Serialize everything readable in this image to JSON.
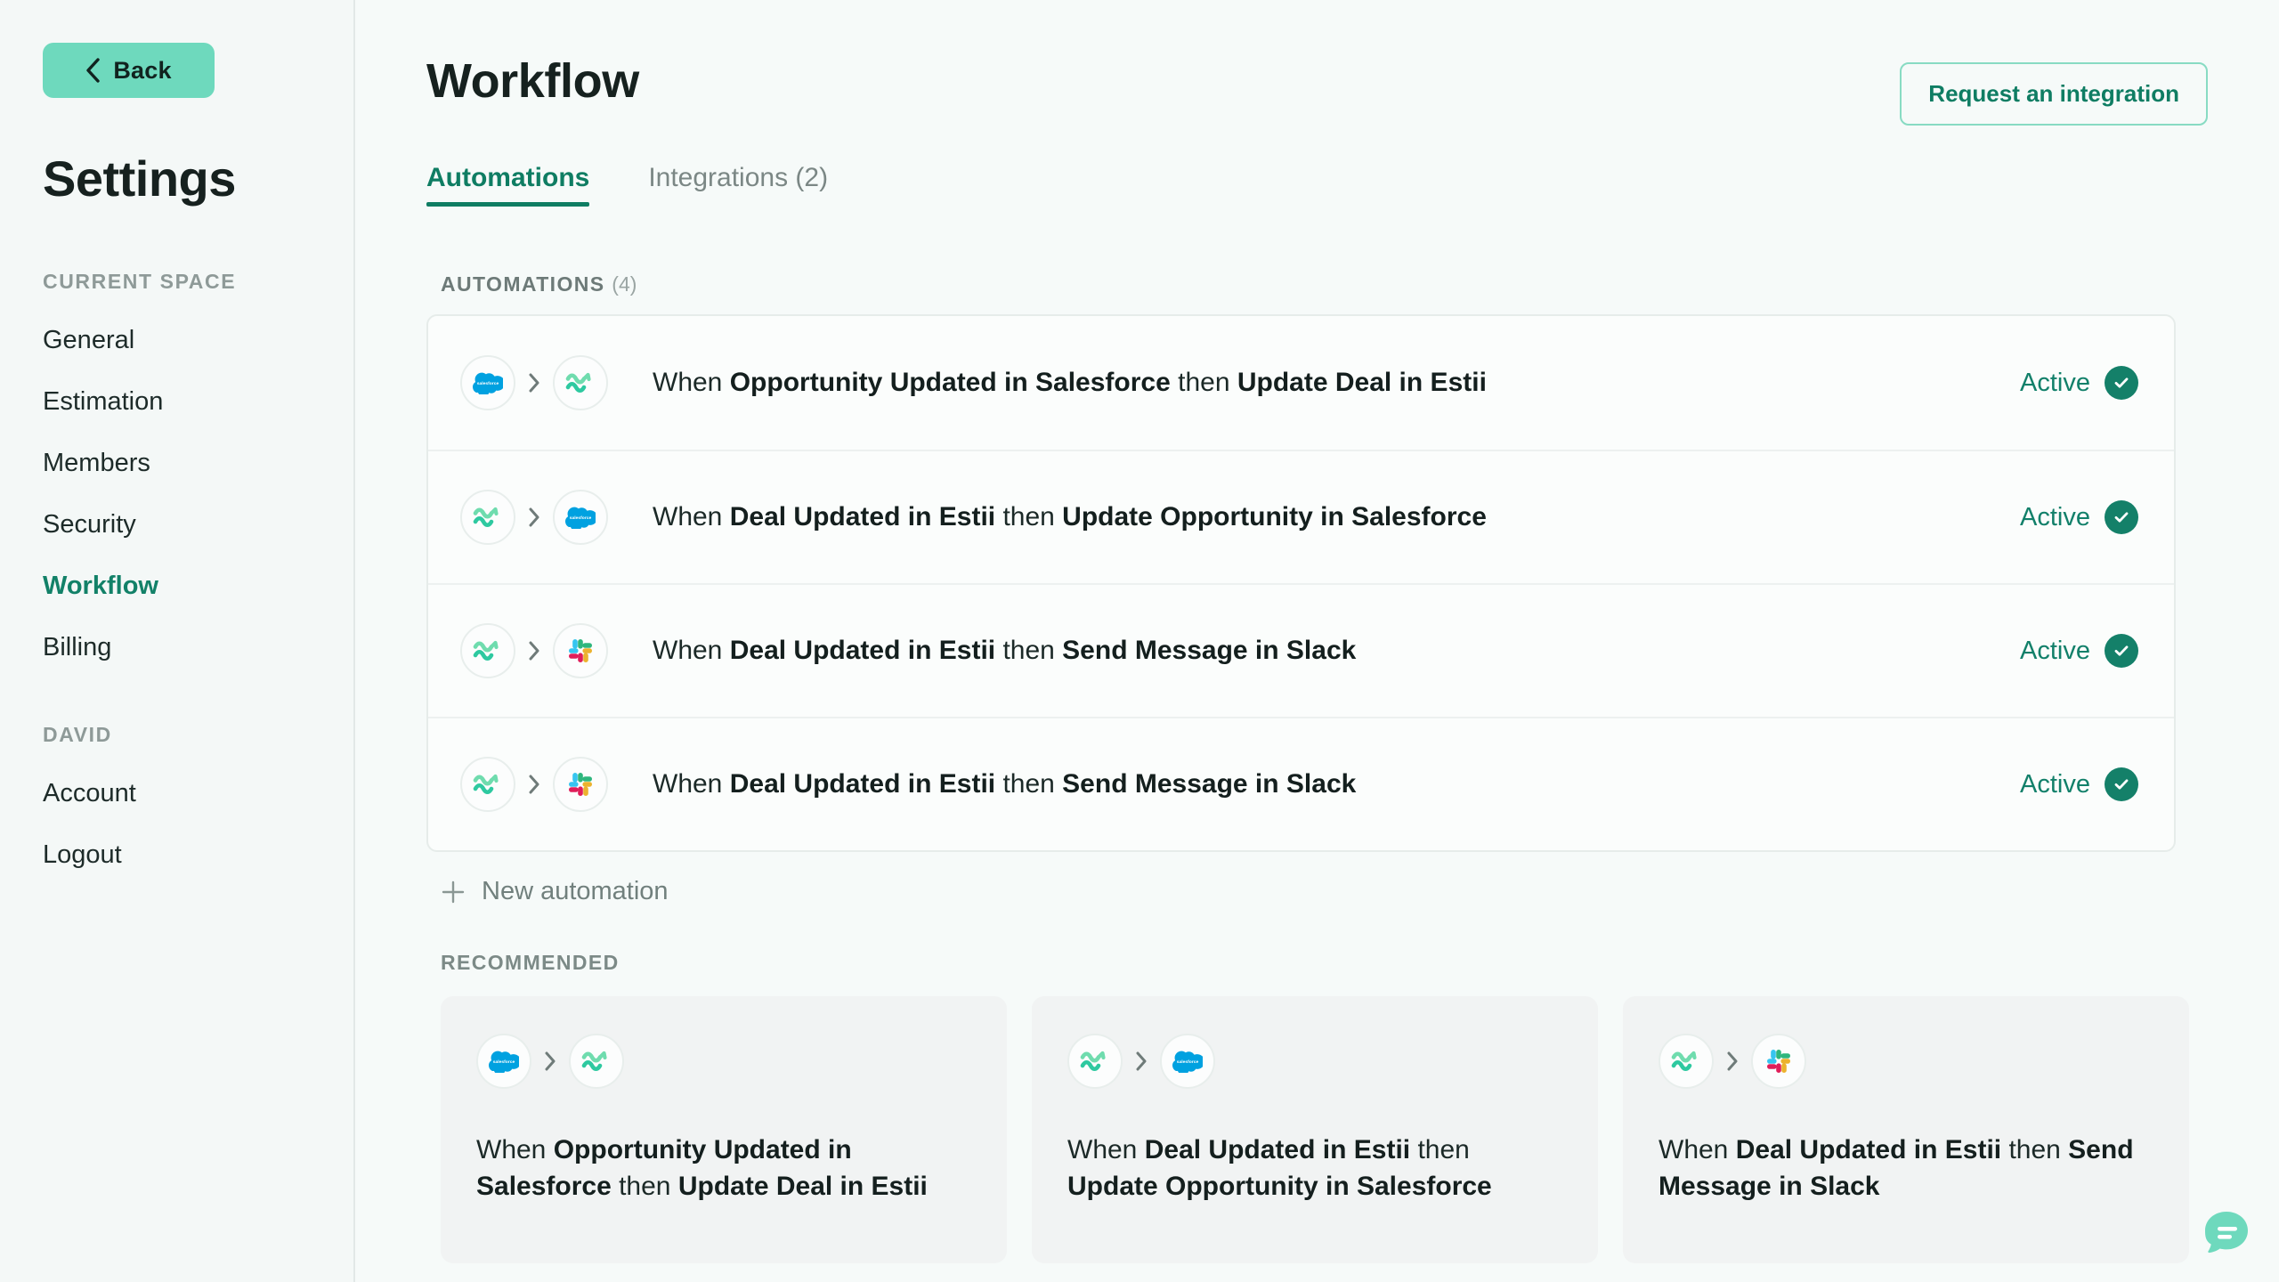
{
  "sidebar": {
    "back_label": "Back",
    "title": "Settings",
    "space_label": "CURRENT SPACE",
    "space_items": [
      {
        "label": "General",
        "active": false
      },
      {
        "label": "Estimation",
        "active": false
      },
      {
        "label": "Members",
        "active": false
      },
      {
        "label": "Security",
        "active": false
      },
      {
        "label": "Workflow",
        "active": true
      },
      {
        "label": "Billing",
        "active": false
      }
    ],
    "user_label": "DAVID",
    "user_items": [
      {
        "label": "Account"
      },
      {
        "label": "Logout"
      }
    ]
  },
  "header": {
    "title": "Workflow",
    "request_button": "Request an integration"
  },
  "tabs": [
    {
      "label": "Automations",
      "active": true
    },
    {
      "label": "Integrations (2)",
      "active": false
    }
  ],
  "automations_section": {
    "label": "AUTOMATIONS",
    "count": "(4)",
    "rows": [
      {
        "source_icon": "salesforce-icon",
        "target_icon": "estii-icon",
        "prefix": "When ",
        "trigger": "Opportunity Updated in Salesforce",
        "middle": " then ",
        "action": "Update Deal in Estii",
        "status": "Active"
      },
      {
        "source_icon": "estii-icon",
        "target_icon": "salesforce-icon",
        "prefix": "When ",
        "trigger": "Deal Updated in Estii",
        "middle": " then ",
        "action": "Update Opportunity in Salesforce",
        "status": "Active"
      },
      {
        "source_icon": "estii-icon",
        "target_icon": "slack-icon",
        "prefix": "When ",
        "trigger": "Deal Updated in Estii",
        "middle": " then ",
        "action": "Send Message in Slack",
        "status": "Active"
      },
      {
        "source_icon": "estii-icon",
        "target_icon": "slack-icon",
        "prefix": "When ",
        "trigger": "Deal Updated in Estii",
        "middle": " then ",
        "action": "Send Message in Slack",
        "status": "Active"
      }
    ],
    "new_automation_label": "New automation"
  },
  "recommended_section": {
    "label": "RECOMMENDED",
    "cards": [
      {
        "source_icon": "salesforce-icon",
        "target_icon": "estii-icon",
        "prefix": "When ",
        "trigger": "Opportunity Updated in Salesforce",
        "middle": " then ",
        "action": "Update Deal in Estii"
      },
      {
        "source_icon": "estii-icon",
        "target_icon": "salesforce-icon",
        "prefix": "When ",
        "trigger": "Deal Updated in Estii",
        "middle": " then ",
        "action": "Update Opportunity in Salesforce"
      },
      {
        "source_icon": "estii-icon",
        "target_icon": "slack-icon",
        "prefix": "When ",
        "trigger": "Deal Updated in Estii",
        "middle": " then ",
        "action": "Send Message in Slack"
      }
    ]
  },
  "chat_widget": {
    "icon": "chat-bubble-icon"
  },
  "colors": {
    "accent_green": "#0f7d63",
    "mint": "#6ed9bd",
    "page_bg": "#f6faf9",
    "sidebar_bg": "#f4f8f7",
    "salesforce_blue": "#00a1e0",
    "estii_teal": "#35c9a0"
  }
}
